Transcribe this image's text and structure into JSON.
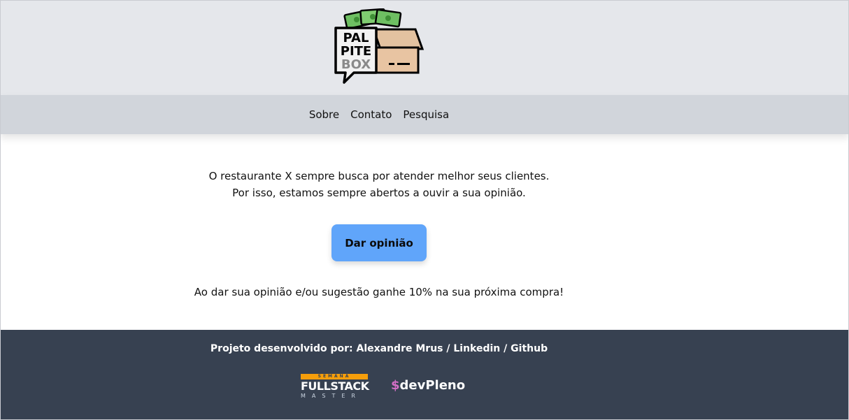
{
  "logo": {
    "line1": "PAL",
    "line2": "PITE",
    "line3": "BOX"
  },
  "nav": {
    "items": [
      "Sobre",
      "Contato",
      "Pesquisa"
    ]
  },
  "main": {
    "intro_line1": "O restaurante X sempre busca por atender melhor seus clientes.",
    "intro_line2": "Por isso, estamos sempre abertos a ouvir a sua opinião.",
    "cta_label": "Dar opinião",
    "promo": "Ao dar sua opinião e/ou sugestão ganhe 10% na sua próxima compra!"
  },
  "footer": {
    "credits_prefix": "Projeto desenvolvido por: ",
    "author": "Alexandre Mrus",
    "sep1": " / ",
    "linkedin": "Linkedin",
    "sep2": " / ",
    "github": "Github",
    "fullstack_top": "SEMANA",
    "fullstack_main": "FULLSTACK",
    "fullstack_sub": "MASTER",
    "devpleno_symbol": "$",
    "devpleno_name": "devPleno"
  },
  "colors": {
    "header_bg": "#e5e7eb",
    "nav_bg": "#d1d5db",
    "cta_bg": "#60a5fa",
    "footer_bg": "#374151",
    "fullstack_accent": "#f59e0b",
    "devpleno_accent": "#d36fc6"
  }
}
